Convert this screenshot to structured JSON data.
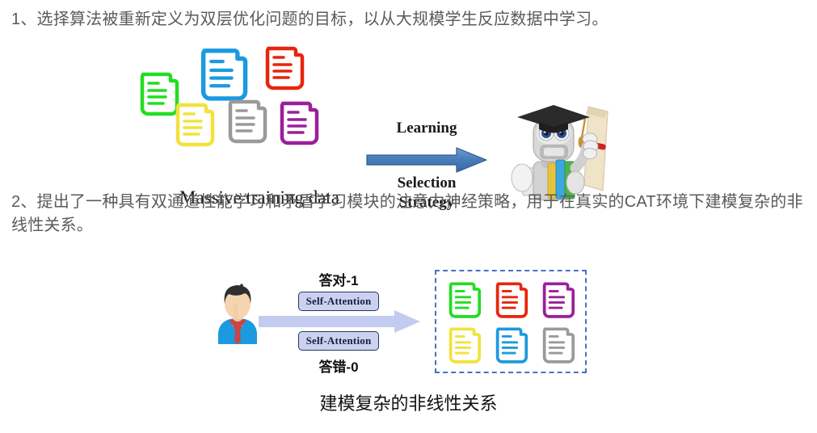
{
  "slide": {
    "background_color": "#ffffff",
    "bullets": [
      {
        "id": "bullet-1",
        "text": "1、选择算法被重新定义为双层优化问题的目标，以从大规模学生反应数据中学习。"
      },
      {
        "id": "bullet-2",
        "text": "2、提出了一种具有双通道性能学习和矛盾学习模块的注意力神经策略，用于在真实的CAT环境下建模复杂的非线性关系。"
      }
    ],
    "text_color": "#5a5a5a"
  },
  "figure1": {
    "caption": "Massive training data",
    "arrow": {
      "label_top": "Learning",
      "label_bottom_line1": "Selection",
      "label_bottom_line2": "Strategy",
      "color": "#4a7ebb",
      "border_color": "#2e5a8e"
    },
    "documents": [
      {
        "name": "document-icon-green",
        "color": "#22dd22"
      },
      {
        "name": "document-icon-blue",
        "color": "#1b9ae0"
      },
      {
        "name": "document-icon-red",
        "color": "#e8250c"
      },
      {
        "name": "document-icon-yellow",
        "color": "#f2e23a"
      },
      {
        "name": "document-icon-gray",
        "color": "#9a9a9a"
      },
      {
        "name": "document-icon-purple",
        "color": "#9b1f9b"
      }
    ],
    "robot": {
      "name": "graduate-robot-icon",
      "cap_color": "#2b2b2b",
      "body_color": "#cfcfcf",
      "tassel_color": "#c8913a",
      "book_colors": [
        "#e8c33a",
        "#3aa7e0",
        "#4cb44c"
      ],
      "scroll_color": "#efe3c8"
    }
  },
  "figure2": {
    "avatar": {
      "name": "student-avatar-icon",
      "hair_color": "#2f2f2f",
      "skin_color": "#f5d5b0",
      "shirt_color": "#1b9ae0",
      "tie_color": "#cc4444"
    },
    "arrow": {
      "color": "#c4cbf0"
    },
    "attention_top": "Self-Attention",
    "attention_bottom": "Self-Attention",
    "correct_label": "答对-1",
    "incorrect_label": "答错-0",
    "attention_box": {
      "fill": "#ccd1ef",
      "border": "#1f3864"
    },
    "question_bank": {
      "border_color": "#4472c4",
      "border_style": "dashed",
      "documents": [
        {
          "name": "document-icon-green",
          "color": "#22dd22"
        },
        {
          "name": "document-icon-red",
          "color": "#e8250c"
        },
        {
          "name": "document-icon-purple",
          "color": "#9b1f9b"
        },
        {
          "name": "document-icon-yellow",
          "color": "#f2e23a"
        },
        {
          "name": "document-icon-blue",
          "color": "#1b9ae0"
        },
        {
          "name": "document-icon-gray",
          "color": "#9a9a9a"
        }
      ]
    },
    "caption": "建模复杂的非线性关系"
  }
}
